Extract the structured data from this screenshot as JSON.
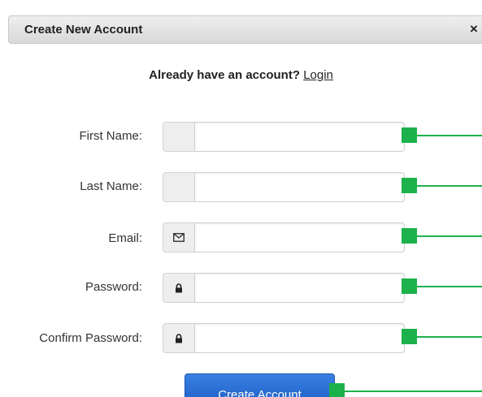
{
  "dialog": {
    "title": "Create New Account",
    "close_label": "×"
  },
  "login": {
    "prompt": "Already have an account?",
    "link": "Login"
  },
  "form": {
    "fields": [
      {
        "label": "First Name:",
        "icon": "blank",
        "value": "",
        "placeholder": ""
      },
      {
        "label": "Last Name:",
        "icon": "blank",
        "value": "",
        "placeholder": ""
      },
      {
        "label": "Email:",
        "icon": "envelope-icon",
        "value": "",
        "placeholder": ""
      },
      {
        "label": "Password:",
        "icon": "lock-icon",
        "value": "",
        "placeholder": ""
      },
      {
        "label": "Confirm Password:",
        "icon": "lock-icon",
        "value": "",
        "placeholder": ""
      }
    ],
    "submit_label": "Create Account"
  },
  "colors": {
    "marker": "#1db14c",
    "button": "#2a6fd8"
  }
}
